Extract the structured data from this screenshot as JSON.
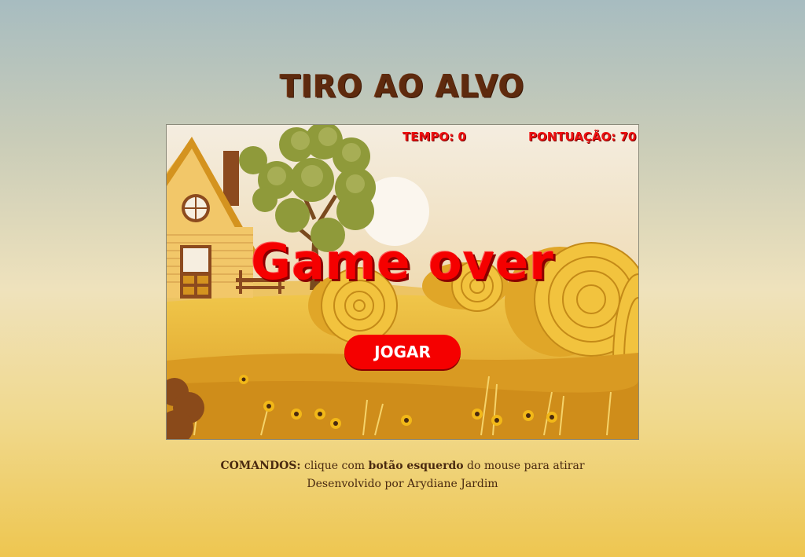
{
  "title": "TIRO AO ALVO",
  "hud": {
    "time_label": "TEMPO: 0",
    "score_label": "PONTUAÇÃO: 70"
  },
  "game_over_text": "Game over",
  "play_button_label": "JOGAR",
  "footer": {
    "commands_label": "COMANDOS:",
    "commands_text_1": "clique com",
    "commands_bold": "botão esquerdo",
    "commands_text_2": "do mouse para atirar",
    "credits": "Desenvolvido por Arydiane Jardim"
  },
  "colors": {
    "title": "#5e2a0e",
    "accent_red": "#f50000",
    "hay": "#e8b530",
    "field": "#d9a533"
  }
}
